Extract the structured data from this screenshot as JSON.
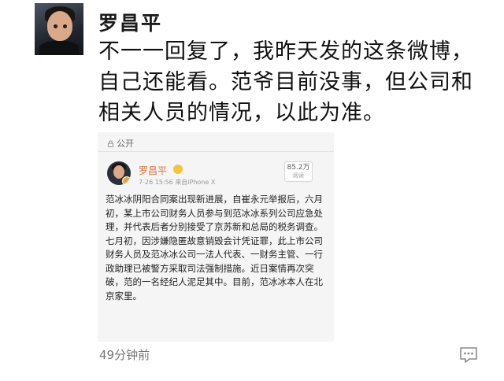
{
  "post": {
    "username": "罗昌平",
    "text": "不一一回复了，我昨天发的这条微博，自己还能看。范爷目前没事，但公司和相关人员的情况，以此为准。",
    "time": "49分钟前"
  },
  "embedded": {
    "visibility": "公开",
    "username": "罗昌平",
    "meta": "7-26 15:56  来自iPhone X",
    "views_count": "85.2万",
    "views_label": "阅读",
    "text": "范冰冰阴阳合同案出现新进展，自崔永元举报后，六月初，某上市公司财务人员参与到范冰冰系列公司应急处理，并代表后者分别接受了京苏新和总局的税务调查。七月初，因涉嫌隐匿故意销毁会计凭证罪，此上市公司财务人员及范冰冰公司一法人代表、一财务主管、一行政助理已被警方采取司法强制措施。近日案情再次突破，范的一名经纪人泥足其中。目前，范冰冰本人在北京家里。"
  },
  "icons": {
    "lock": "lock-icon",
    "vip": "vip-badge-icon",
    "comment": "comment-icon"
  },
  "colors": {
    "inner_username": "#e2703a",
    "card_bg": "#f5f5f5"
  }
}
